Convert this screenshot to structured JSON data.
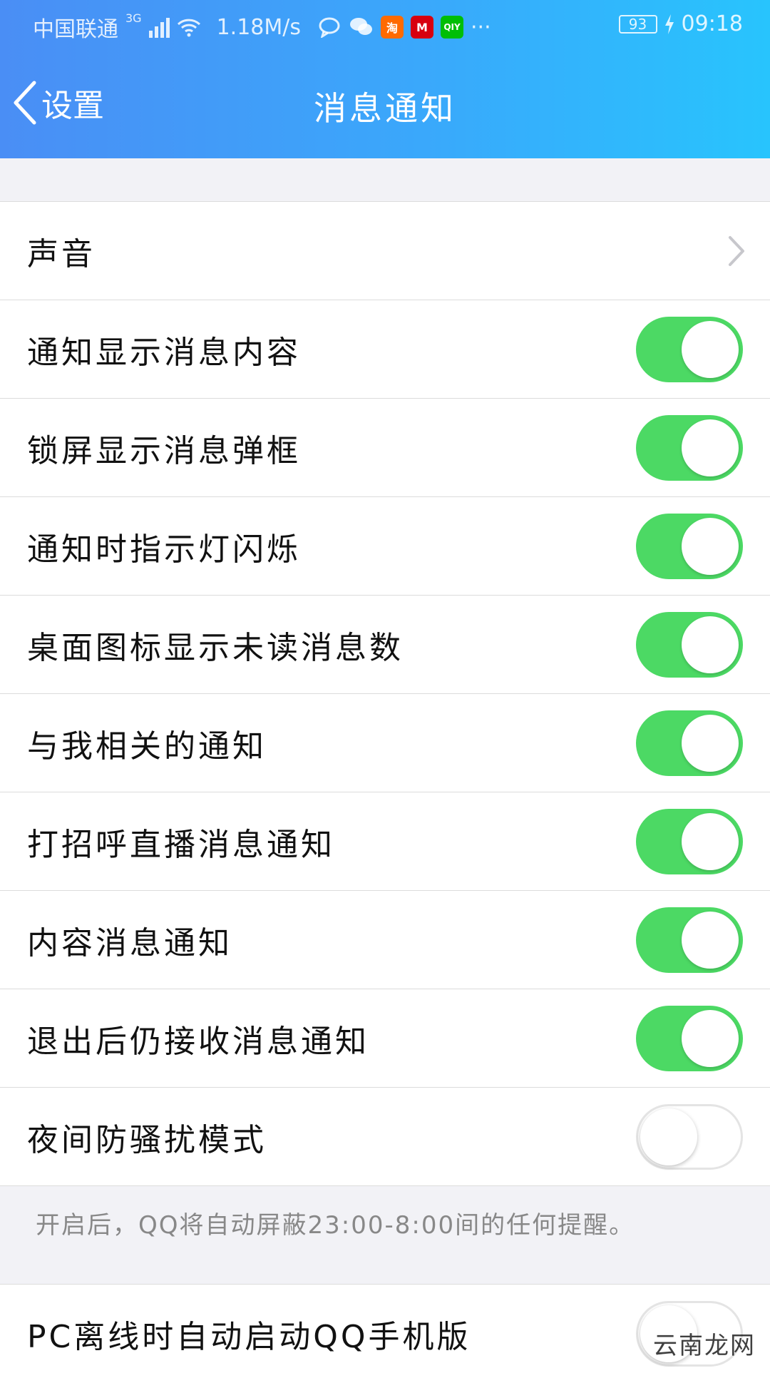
{
  "status_bar": {
    "carrier": "中国联通",
    "network": "3G",
    "speed": "1.18M/s",
    "battery": "93",
    "time": "09:18",
    "more": "···",
    "app_icons": [
      {
        "name": "taobao-icon",
        "label": "淘",
        "color": "#ff6a00"
      },
      {
        "name": "cmb-icon",
        "label": "M",
        "color": "#d7000f"
      },
      {
        "name": "iqiyi-icon",
        "label": "QIY",
        "color": "#00be06"
      }
    ]
  },
  "nav": {
    "back_label": "设置",
    "title": "消息通知"
  },
  "sound_row": {
    "label": "声音"
  },
  "toggle_rows": [
    {
      "label": "通知显示消息内容",
      "on": true
    },
    {
      "label": "锁屏显示消息弹框",
      "on": true
    },
    {
      "label": "通知时指示灯闪烁",
      "on": true
    },
    {
      "label": "桌面图标显示未读消息数",
      "on": true
    },
    {
      "label": "与我相关的通知",
      "on": true
    },
    {
      "label": "打招呼直播消息通知",
      "on": true
    },
    {
      "label": "内容消息通知",
      "on": true
    },
    {
      "label": "退出后仍接收消息通知",
      "on": true
    },
    {
      "label": "夜间防骚扰模式",
      "on": false
    }
  ],
  "night_mode_note": "开启后，QQ将自动屏蔽23:00-8:00间的任何提醒。",
  "pc_row": {
    "label": "PC离线时自动启动QQ手机版",
    "on": false
  },
  "watermark": "云南龙网",
  "colors": {
    "toggle_on": "#4cd964",
    "header_start": "#4a8ef5",
    "header_end": "#28c4fd"
  }
}
